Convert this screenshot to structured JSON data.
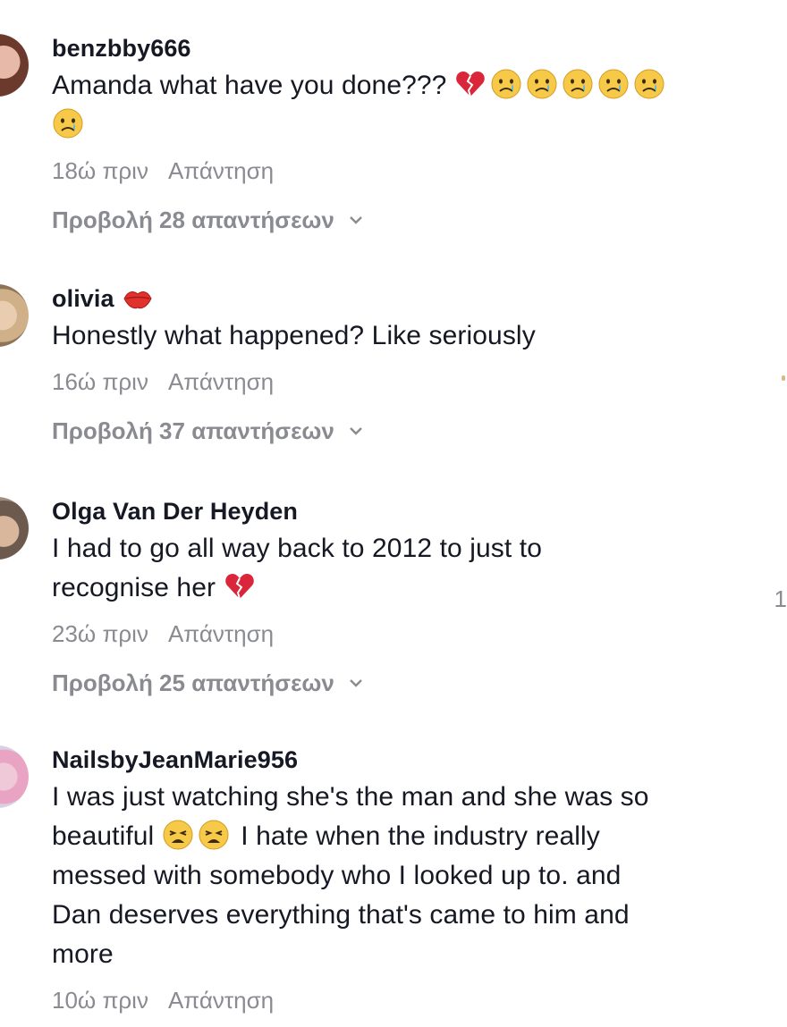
{
  "comments": [
    {
      "username": "benzbby666",
      "text": "Amanda what have you done???",
      "emojis": [
        "broken-heart",
        "crying-face",
        "crying-face",
        "crying-face",
        "crying-face",
        "crying-face",
        "crying-face"
      ],
      "time": "18ώ πριν",
      "reply_label": "Απάντηση",
      "view_replies": "Προβολή 28 απαντήσεων"
    },
    {
      "username": "olivia",
      "username_emoji": "kiss-lips",
      "text": "Honestly what happened? Like seriously",
      "time": "16ώ πριν",
      "reply_label": "Απάντηση",
      "view_replies": "Προβολή 37 απαντήσεων"
    },
    {
      "username": "Olga Van Der Heyden",
      "text_line1": "I had to go all way back to 2012 to just to",
      "text_line2": "recognise her",
      "emojis": [
        "broken-heart"
      ],
      "time": "23ώ πριν",
      "reply_label": "Απάντηση",
      "view_replies": "Προβολή 25 απαντήσεων"
    },
    {
      "username": "NailsbyJeanMarie956",
      "text_line1": "I was just watching she's the man and she was so",
      "text_line2_prefix": "beautiful",
      "emojis": [
        "weary-face",
        "weary-face"
      ],
      "text_line2_suffix": "I hate when the industry really",
      "text_line3": "messed with somebody who I looked up to. and",
      "text_line4": "Dan deserves everything that's came to him and",
      "text_line5": "more",
      "time": "10ώ πριν",
      "reply_label": "Απάντηση"
    }
  ],
  "edge_text": "1",
  "colors": {
    "text": "#161823",
    "muted": "#8a8b91",
    "heart": "#d9263a",
    "emoji_face": "#f7c948"
  }
}
